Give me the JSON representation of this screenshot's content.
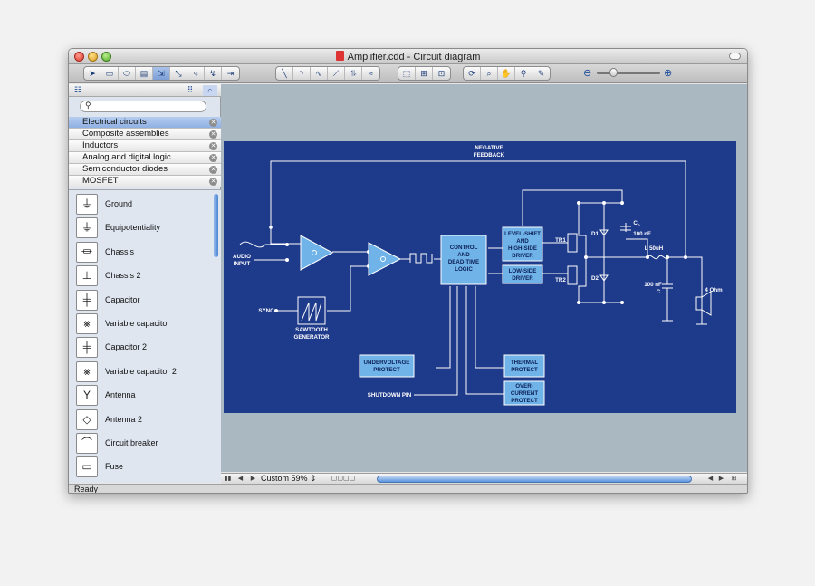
{
  "window": {
    "title": "Amplifier.cdd - Circuit diagram"
  },
  "libraries": [
    {
      "label": "Electrical circuits",
      "selected": true
    },
    {
      "label": "Composite assemblies",
      "selected": false
    },
    {
      "label": "Inductors",
      "selected": false
    },
    {
      "label": "Analog and digital logic",
      "selected": false
    },
    {
      "label": "Semiconductor diodes",
      "selected": false
    },
    {
      "label": "MOSFET",
      "selected": false
    }
  ],
  "shapes": [
    {
      "label": "Ground",
      "glyph": "⏚"
    },
    {
      "label": "Equipotentiality",
      "glyph": "⏚"
    },
    {
      "label": "Chassis",
      "glyph": "⏛"
    },
    {
      "label": "Chassis 2",
      "glyph": "⊥"
    },
    {
      "label": "Capacitor",
      "glyph": "╪"
    },
    {
      "label": "Variable capacitor",
      "glyph": "⨳"
    },
    {
      "label": "Capacitor 2",
      "glyph": "╪"
    },
    {
      "label": "Variable capacitor 2",
      "glyph": "⨳"
    },
    {
      "label": "Antenna",
      "glyph": "Y"
    },
    {
      "label": "Antenna 2",
      "glyph": "◇"
    },
    {
      "label": "Circuit breaker",
      "glyph": "⌒"
    },
    {
      "label": "Fuse",
      "glyph": "▭"
    }
  ],
  "zoom": {
    "label": "Custom 59%"
  },
  "status": {
    "text": "Ready"
  },
  "diagram": {
    "negative_feedback": [
      "NEGATIVE",
      "FEEDBACK"
    ],
    "audio_input": [
      "AUDIO",
      "INPUT"
    ],
    "sync": "SYNC",
    "sawtooth": [
      "SAWTOOTH",
      "GENERATOR"
    ],
    "control": [
      "CONTROL",
      "AND",
      "DEAD-TIME",
      "LOGIC"
    ],
    "level_shift": [
      "LEVEL-SHIFT",
      "AND",
      "HIGH-SIDE",
      "DRIVER"
    ],
    "low_side": [
      "LOW-SIDE",
      "DRIVER"
    ],
    "undervoltage": [
      "UNDERVOLTAGE",
      "PROTECT"
    ],
    "thermal": [
      "THERMAL",
      "PROTECT"
    ],
    "overcurrent": [
      "OVER-",
      "CURRENT",
      "PROTECT"
    ],
    "shutdown": "SHUTDOWN PIN",
    "tr1": "TR1",
    "tr2": "TR2",
    "d1": "D1",
    "d2": "D2",
    "cb": "C",
    "cb_sub": "b",
    "cb_val": "100 nF",
    "inductor": "L  50uH",
    "cap_val": "100 nF",
    "cap_name": "C",
    "speaker": "4 Ohm"
  }
}
